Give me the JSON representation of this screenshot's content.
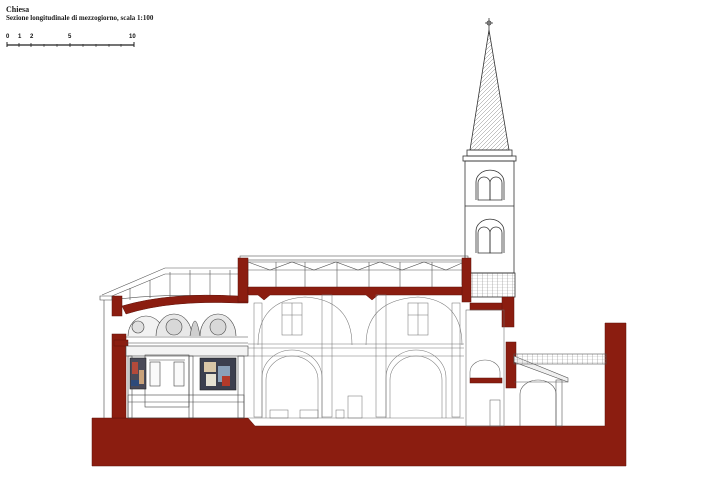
{
  "title": "Chiesa",
  "subtitle": "Sezione longitudinale di mezzogiorno, scala 1:100",
  "scale_bar": {
    "ticks": [
      "0",
      "1",
      "2",
      "5",
      "10"
    ]
  },
  "colors": {
    "section_cut": "#8b1d10",
    "line": "#333333",
    "light_line": "#9a9a9a",
    "background": "#ffffff"
  }
}
